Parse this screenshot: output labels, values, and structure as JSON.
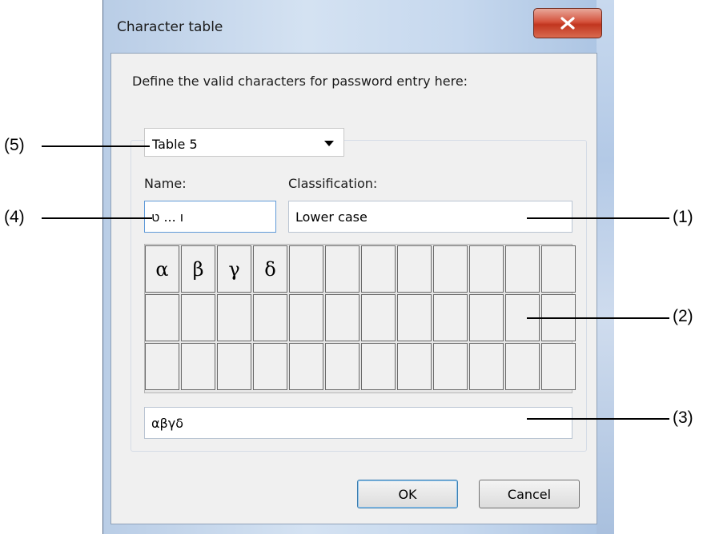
{
  "dialog": {
    "title": "Character table",
    "instruction": "Define the valid characters for password entry here:",
    "table_select": "Table 5",
    "name_label": "Name:",
    "name_value": "ו ... ט",
    "classification_label": "Classification:",
    "classification_value": "Lower case",
    "characters_row1": [
      "α",
      "β",
      "γ",
      "δ",
      "",
      "",
      "",
      "",
      "",
      "",
      "",
      ""
    ],
    "characters_row2": [
      "",
      "",
      "",
      "",
      "",
      "",
      "",
      "",
      "",
      "",
      "",
      ""
    ],
    "characters_row3": [
      "",
      "",
      "",
      "",
      "",
      "",
      "",
      "",
      "",
      "",
      "",
      ""
    ],
    "valid_chars_value": "αβγδ",
    "ok_label": "OK",
    "cancel_label": "Cancel"
  },
  "callouts": {
    "c1": "(1)",
    "c2": "(2)",
    "c3": "(3)",
    "c4": "(4)",
    "c5": "(5)"
  },
  "icons": {
    "close": "close-icon",
    "dropdown": "chevron-down-icon"
  },
  "colors": {
    "close_button": "#c1361f",
    "frame": "#b9cde6"
  }
}
